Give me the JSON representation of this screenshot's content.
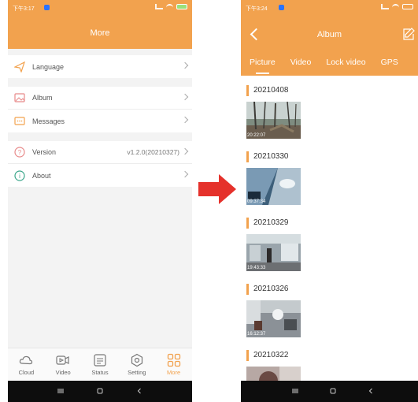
{
  "left_screen": {
    "status": {
      "time": "下午3:17"
    },
    "header": {
      "title": "More"
    },
    "menu": [
      {
        "label": "Language",
        "icon": "paper-plane-icon"
      },
      {
        "label": "Album",
        "icon": "image-icon"
      },
      {
        "label": "Messages",
        "icon": "message-icon"
      },
      {
        "label": "Version",
        "icon": "question-icon",
        "value": "v1.2.0(20210327)"
      },
      {
        "label": "About",
        "icon": "info-icon"
      }
    ],
    "tabs": [
      {
        "label": "Cloud",
        "icon": "cloud-icon"
      },
      {
        "label": "Video",
        "icon": "video-icon"
      },
      {
        "label": "Status",
        "icon": "status-icon"
      },
      {
        "label": "Setting",
        "icon": "gear-icon"
      },
      {
        "label": "More",
        "icon": "grid-icon",
        "active": true
      }
    ]
  },
  "right_screen": {
    "status": {
      "time": "下午3:24"
    },
    "header": {
      "title": "Album"
    },
    "tabs": [
      "Picture",
      "Video",
      "Lock video",
      "GPS"
    ],
    "groups": [
      {
        "date": "20210408",
        "timestamp": "20:22:07"
      },
      {
        "date": "20210330",
        "timestamp": "09:37:34"
      },
      {
        "date": "20210329",
        "timestamp": "19:43:33"
      },
      {
        "date": "20210326",
        "timestamp": "16:12:37"
      },
      {
        "date": "20210322",
        "timestamp": ""
      }
    ]
  },
  "colors": {
    "accent": "#f2a24e",
    "arrow": "#e5312b",
    "nav_bar": "#0d0d0d"
  }
}
